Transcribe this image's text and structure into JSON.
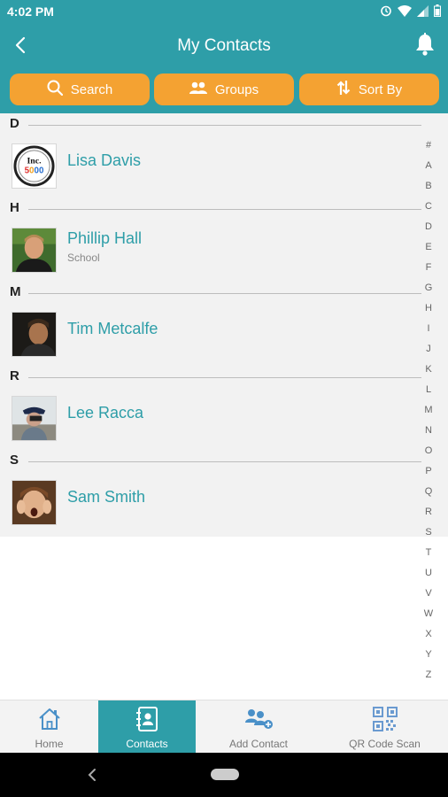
{
  "status_bar": {
    "time": "4:02 PM"
  },
  "header": {
    "title": "My Contacts",
    "back_icon": "chevron-left-icon",
    "bell_icon": "bell-icon"
  },
  "actions": [
    {
      "label": "Search",
      "icon": "search-icon"
    },
    {
      "label": "Groups",
      "icon": "groups-icon"
    },
    {
      "label": "Sort By",
      "icon": "sort-icon"
    }
  ],
  "sections": [
    {
      "letter": "D",
      "contacts": [
        {
          "name": "Lisa Davis",
          "subtitle": "",
          "avatar": "inc-5000-logo"
        }
      ]
    },
    {
      "letter": "H",
      "contacts": [
        {
          "name": "Phillip Hall",
          "subtitle": "School",
          "avatar": "photo"
        }
      ]
    },
    {
      "letter": "M",
      "contacts": [
        {
          "name": "Tim Metcalfe",
          "subtitle": "",
          "avatar": "photo"
        }
      ]
    },
    {
      "letter": "R",
      "contacts": [
        {
          "name": "Lee Racca",
          "subtitle": "",
          "avatar": "photo"
        }
      ]
    },
    {
      "letter": "S",
      "contacts": [
        {
          "name": "Sam Smith",
          "subtitle": "",
          "avatar": "photo"
        }
      ]
    }
  ],
  "alpha_index": [
    "#",
    "A",
    "B",
    "C",
    "D",
    "E",
    "F",
    "G",
    "H",
    "I",
    "J",
    "K",
    "L",
    "M",
    "N",
    "O",
    "P",
    "Q",
    "R",
    "S",
    "T",
    "U",
    "V",
    "W",
    "X",
    "Y",
    "Z"
  ],
  "bottom_nav": [
    {
      "label": "Home",
      "icon": "home-icon",
      "active": false
    },
    {
      "label": "Contacts",
      "icon": "contacts-icon",
      "active": true
    },
    {
      "label": "Add Contact",
      "icon": "add-contact-icon",
      "active": false
    },
    {
      "label": "QR Code Scan",
      "icon": "qr-code-icon",
      "active": false
    }
  ],
  "colors": {
    "primary": "#2e9ea8",
    "accent": "#f4a232",
    "list_bg": "#f2f2f2"
  }
}
